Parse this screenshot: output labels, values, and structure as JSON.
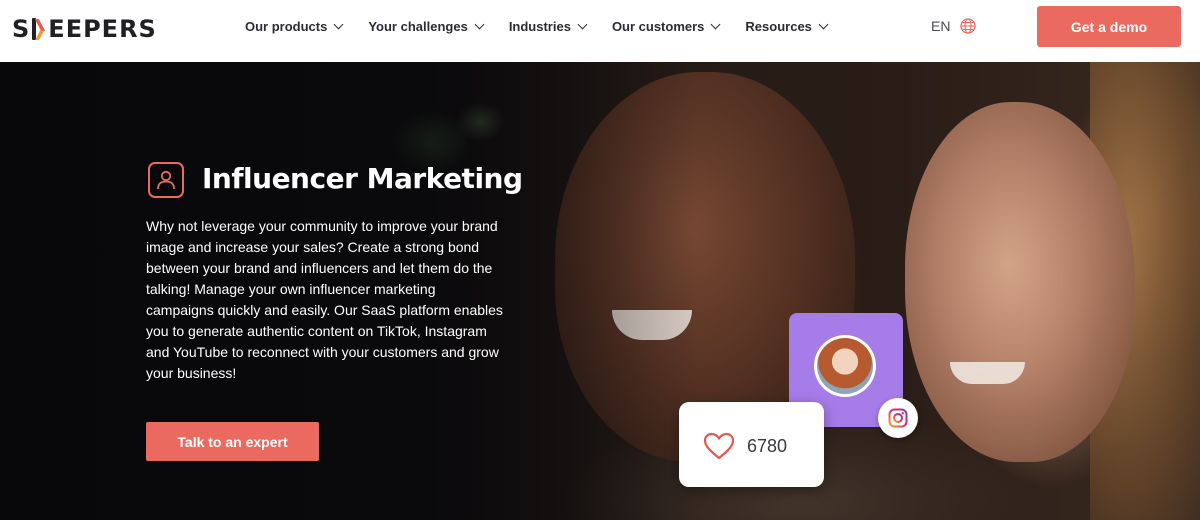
{
  "brand": {
    "logo_text_before": "S",
    "logo_text_after": "EEPERS",
    "logo_alt": "SKEEPERS",
    "accent_color": "#ea6a60"
  },
  "nav": {
    "items": [
      {
        "label": "Our products"
      },
      {
        "label": "Your challenges"
      },
      {
        "label": "Industries"
      },
      {
        "label": "Our customers"
      },
      {
        "label": "Resources"
      }
    ],
    "language": "EN",
    "language_icon": "globe-icon",
    "cta_label": "Get a demo"
  },
  "hero": {
    "icon": "user-icon",
    "title": "Influencer Marketing",
    "description": "Why not leverage your community to improve your brand image and increase your sales? Create a strong bond between your brand and influencers and let them do the talking! Manage your own influencer marketing campaigns quickly and easily. Our SaaS platform enables you to generate authentic content on TikTok, Instagram and YouTube to reconnect with your customers and grow your business!",
    "cta_label": "Talk to an expert"
  },
  "cards": {
    "like_count": "6780",
    "like_icon": "heart-icon",
    "social_icon": "instagram-icon",
    "card_color": "#a67ce8"
  }
}
